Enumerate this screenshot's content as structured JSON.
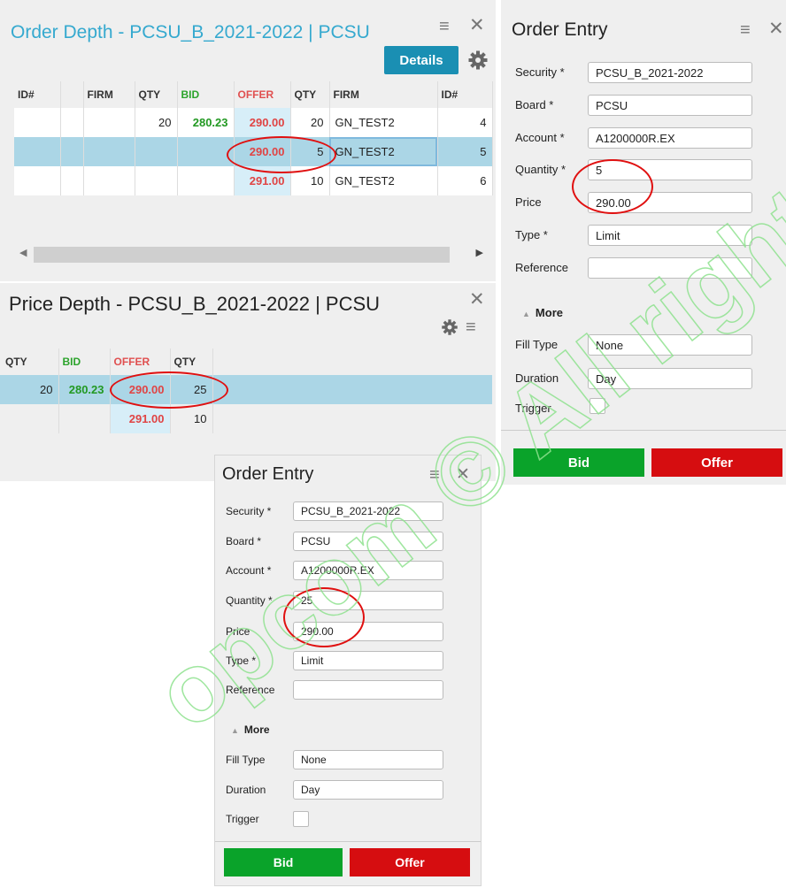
{
  "order_depth": {
    "title": "Order Depth - PCSU_B_2021-2022 | PCSU",
    "details_label": "Details",
    "columns": [
      "ID#",
      "",
      "FIRM",
      "QTY",
      "BID",
      "OFFER",
      "QTY",
      "FIRM",
      "ID#"
    ],
    "rows": [
      {
        "bid_id": "",
        "bid_firm": "",
        "bid_qty": "20",
        "bid": "280.23",
        "offer": "290.00",
        "offer_qty": "20",
        "offer_firm": "GN_TEST2",
        "offer_id": "4",
        "selected": false
      },
      {
        "bid_id": "",
        "bid_firm": "",
        "bid_qty": "",
        "bid": "",
        "offer": "290.00",
        "offer_qty": "5",
        "offer_firm": "GN_TEST2",
        "offer_id": "5",
        "selected": true
      },
      {
        "bid_id": "",
        "bid_firm": "",
        "bid_qty": "",
        "bid": "",
        "offer": "291.00",
        "offer_qty": "10",
        "offer_firm": "GN_TEST2",
        "offer_id": "6",
        "selected": false
      }
    ]
  },
  "price_depth": {
    "title": "Price Depth - PCSU_B_2021-2022 | PCSU",
    "columns": [
      "QTY",
      "BID",
      "OFFER",
      "QTY"
    ],
    "rows": [
      {
        "bid_qty": "20",
        "bid": "280.23",
        "offer": "290.00",
        "offer_qty": "25",
        "selected": true
      },
      {
        "bid_qty": "",
        "bid": "",
        "offer": "291.00",
        "offer_qty": "10",
        "selected": false
      }
    ]
  },
  "order_entry_main": {
    "title": "Order Entry",
    "fields": {
      "security": {
        "label": "Security *",
        "value": "PCSU_B_2021-2022"
      },
      "board": {
        "label": "Board *",
        "value": "PCSU"
      },
      "account": {
        "label": "Account *",
        "value": "A1200000R.EX"
      },
      "quantity": {
        "label": "Quantity *",
        "value": "5"
      },
      "price": {
        "label": "Price",
        "value": "290.00"
      },
      "type": {
        "label": "Type *",
        "value": "Limit"
      },
      "reference": {
        "label": "Reference",
        "value": ""
      },
      "fill_type": {
        "label": "Fill Type",
        "value": "None"
      },
      "duration": {
        "label": "Duration",
        "value": "Day"
      },
      "trigger": {
        "label": "Trigger"
      }
    },
    "more_label": "More",
    "bid_label": "Bid",
    "offer_label": "Offer"
  },
  "order_entry_popup": {
    "title": "Order Entry",
    "fields": {
      "security": {
        "label": "Security *",
        "value": "PCSU_B_2021-2022"
      },
      "board": {
        "label": "Board *",
        "value": "PCSU"
      },
      "account": {
        "label": "Account *",
        "value": "A1200000R.EX"
      },
      "quantity": {
        "label": "Quantity *",
        "value": "25"
      },
      "price": {
        "label": "Price",
        "value": "290.00"
      },
      "type": {
        "label": "Type *",
        "value": "Limit"
      },
      "reference": {
        "label": "Reference",
        "value": ""
      },
      "fill_type": {
        "label": "Fill Type",
        "value": "None"
      },
      "duration": {
        "label": "Duration",
        "value": "Day"
      },
      "trigger": {
        "label": "Trigger"
      }
    },
    "more_label": "More",
    "bid_label": "Bid",
    "offer_label": "Offer"
  },
  "icons": {
    "menu": "hamburger-icon",
    "close": "close-icon",
    "settings": "gear-icon",
    "scroll_left": "arrow-left-icon",
    "scroll_right": "arrow-right-icon",
    "collapse": "caret-up-icon"
  },
  "colors": {
    "accent": "#35a9cf",
    "details_button": "#1a8fb3",
    "bid_text": "#229922",
    "offer_text": "#e04444",
    "selected_row": "#abd6e6",
    "bid_button": "#0aa32a",
    "offer_button": "#d60d10",
    "annotation": "#e01010"
  },
  "watermark": {
    "text": "opcom © All rights reserved"
  }
}
